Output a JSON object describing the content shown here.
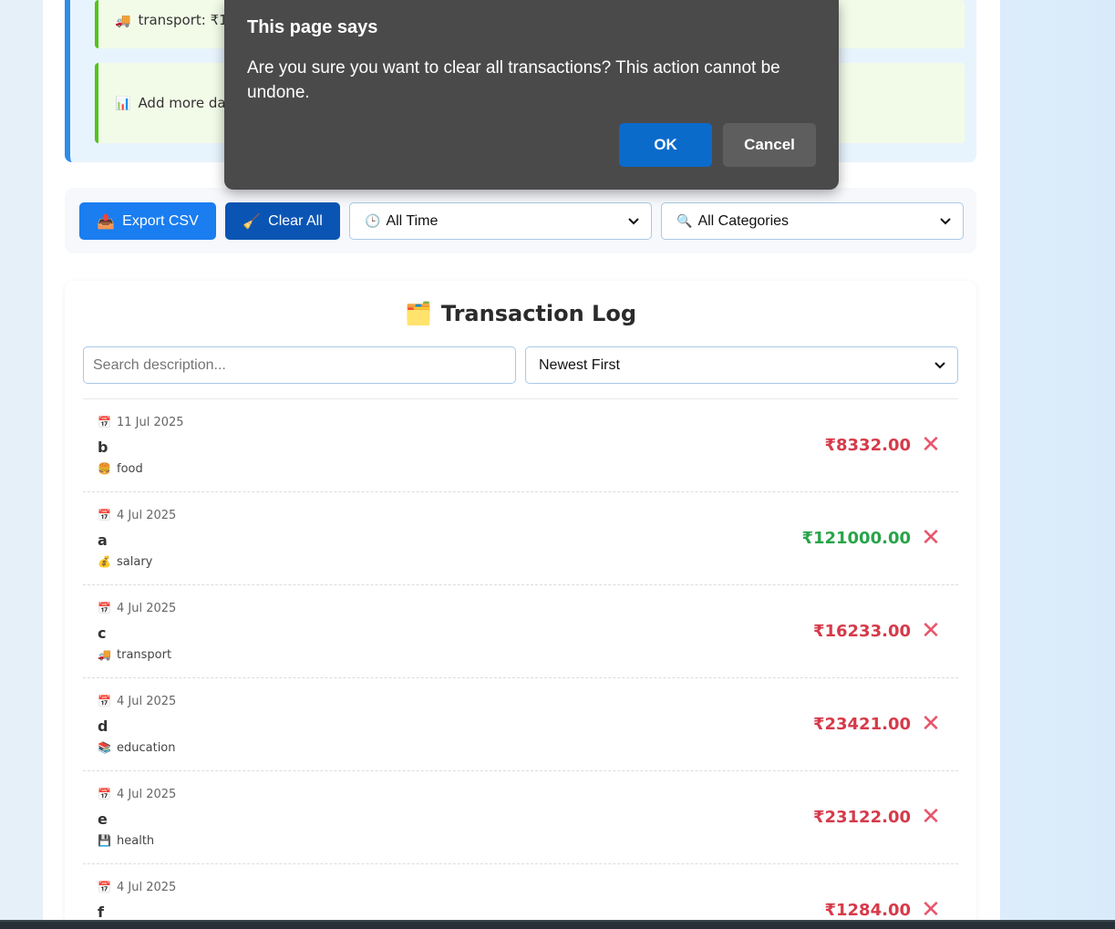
{
  "insights": {
    "cards": [
      {
        "icon": "🚚",
        "text": "transport: ₹16233.00 (most spent category)"
      },
      {
        "icon": "📊",
        "text": "Add more data to unlock more insights"
      }
    ]
  },
  "toolbar": {
    "export_icon": "📤",
    "export_label": "Export CSV",
    "clear_icon": "🧹",
    "clear_label": "Clear All",
    "time_filter": {
      "icon": "🕒",
      "value": "All Time"
    },
    "category_filter": {
      "icon": "🔍",
      "value": "All Categories"
    }
  },
  "log": {
    "title_icon": "🗂️",
    "title": "Transaction Log",
    "search_placeholder": "Search description...",
    "sort_value": "Newest First",
    "transactions": [
      {
        "date": "11 Jul 2025",
        "description": "b",
        "category_icon": "🍔",
        "category": "food",
        "amount": "₹8332.00",
        "type": "expense"
      },
      {
        "date": "4 Jul 2025",
        "description": "a",
        "category_icon": "💰",
        "category": "salary",
        "amount": "₹121000.00",
        "type": "income"
      },
      {
        "date": "4 Jul 2025",
        "description": "c",
        "category_icon": "🚚",
        "category": "transport",
        "amount": "₹16233.00",
        "type": "expense"
      },
      {
        "date": "4 Jul 2025",
        "description": "d",
        "category_icon": "📚",
        "category": "education",
        "amount": "₹23421.00",
        "type": "expense"
      },
      {
        "date": "4 Jul 2025",
        "description": "e",
        "category_icon": "💾",
        "category": "health",
        "amount": "₹23122.00",
        "type": "expense"
      },
      {
        "date": "4 Jul 2025",
        "description": "f",
        "category_icon": "",
        "category": "",
        "amount": "₹1284.00",
        "type": "expense"
      }
    ],
    "delete_glyph": "✕",
    "date_icon": "📅"
  },
  "dialog": {
    "title": "This page says",
    "message": "Are you sure you want to clear all transactions? This action cannot be undone.",
    "ok_label": "OK",
    "cancel_label": "Cancel"
  },
  "colors": {
    "primary": "#1a7df0",
    "expense": "#d63a4a",
    "income": "#28a44a",
    "delete": "#e8556b",
    "dialog_bg": "#4a4a4a"
  }
}
